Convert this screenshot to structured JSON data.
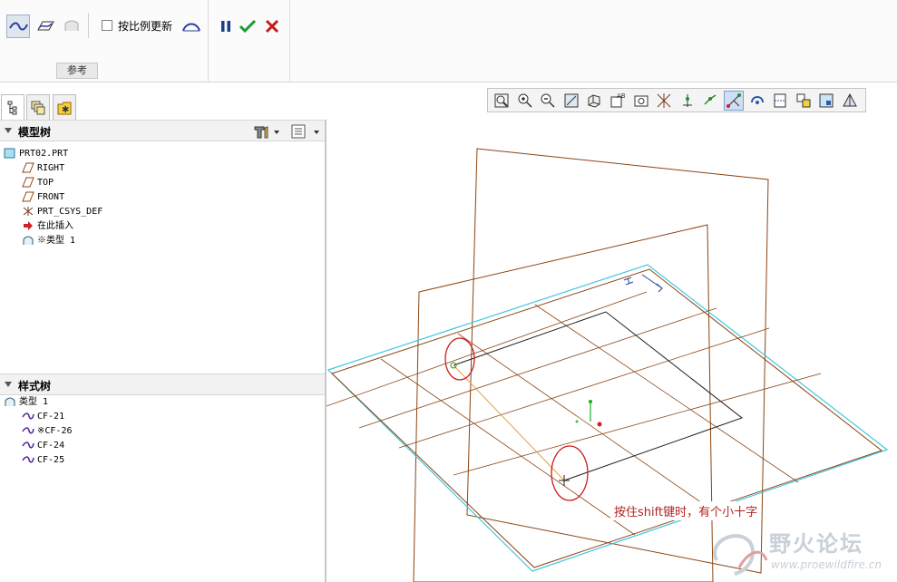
{
  "ribbon": {
    "checkbox_label": "按比例更新",
    "checkbox_checked": false,
    "group_label": "参考",
    "buttons": [
      "curve-icon",
      "plane-curve-icon",
      "surface-icon",
      "section-icon"
    ],
    "pause_icon": "pause-icon",
    "confirm_icon": "check-icon",
    "cancel_icon": "cancel-icon"
  },
  "panel_tabs": [
    "model-tree-tab",
    "layers-tab",
    "favorites-tab"
  ],
  "model_tree": {
    "title": "模型树",
    "items": [
      {
        "label": "PRT02.PRT",
        "icon": "part-icon",
        "indent": 0
      },
      {
        "label": "RIGHT",
        "icon": "datum-plane-icon",
        "indent": 1
      },
      {
        "label": "TOP",
        "icon": "datum-plane-icon",
        "indent": 1
      },
      {
        "label": "FRONT",
        "icon": "datum-plane-icon",
        "indent": 1
      },
      {
        "label": "PRT_CSYS_DEF",
        "icon": "csys-icon",
        "indent": 1
      },
      {
        "label": "在此插入",
        "icon": "insert-arrow-icon",
        "indent": 1
      },
      {
        "label": "※类型 1",
        "icon": "style-feature-icon",
        "indent": 1
      }
    ]
  },
  "style_tree": {
    "title": "样式树",
    "items": [
      {
        "label": "类型 1",
        "icon": "style-feature-icon",
        "indent": 0
      },
      {
        "label": "CF-21",
        "icon": "curve-icon",
        "indent": 1
      },
      {
        "label": "※CF-26",
        "icon": "curve-icon",
        "indent": 1
      },
      {
        "label": "CF-24",
        "icon": "curve-icon",
        "indent": 1
      },
      {
        "label": "CF-25",
        "icon": "curve-icon",
        "indent": 1
      }
    ]
  },
  "view_toolbar": [
    "refit-icon",
    "zoom-in-icon",
    "zoom-out-icon",
    "repaint-icon",
    "display-style-icon",
    "saved-views-icon",
    "view-manager-icon",
    "datum-display-icon",
    "axis-display-icon",
    "point-display-icon",
    "csys-display-icon",
    "spin-center-icon",
    "annotation-icon",
    "navigator-icon",
    "section-view-icon",
    "perspective-icon"
  ],
  "view_toolbar_active_index": 10,
  "annotation": "按住shift键时，有个小十字",
  "watermark": {
    "text": "野火论坛",
    "url": "www.proewildfire.cn"
  },
  "colors": {
    "datum_plane": "#8b4513",
    "sketch_plane": "#40c8e0",
    "annotation": "#b22222",
    "accent_selected": "#cfe0f5"
  }
}
